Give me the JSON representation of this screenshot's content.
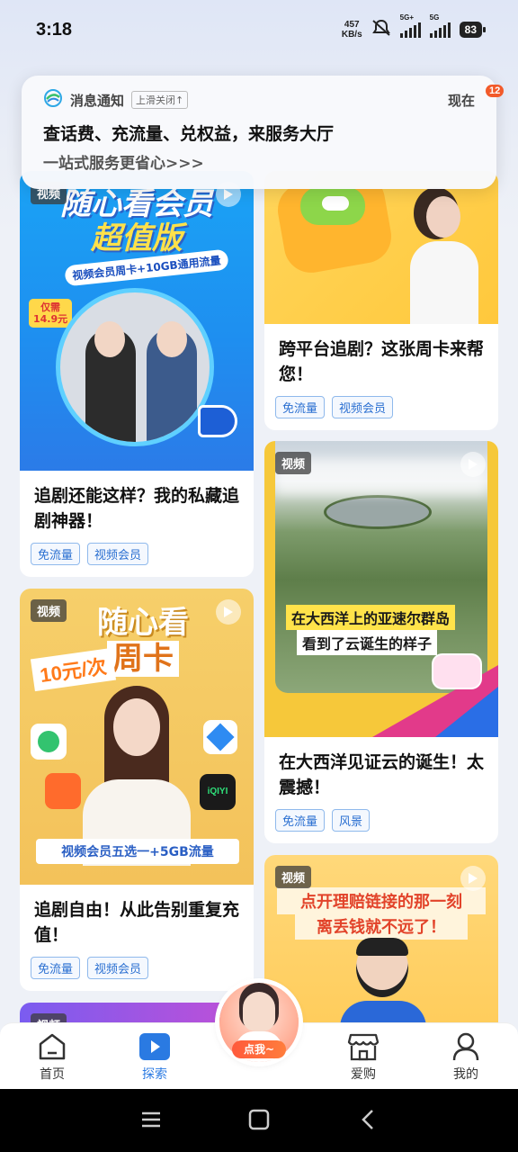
{
  "status_bar": {
    "time": "3:18",
    "net_speed": "457",
    "net_unit": "KB/s",
    "sim1": "5G+",
    "sim2": "5G",
    "battery": "83"
  },
  "notification": {
    "app_name": "消息通知",
    "dismiss_hint": "上滑关闭↑",
    "time": "现在",
    "title": "查话费、充流量、兑权益，来服务大厅",
    "body": "一站式服务更省心>>>",
    "unread_count": "12"
  },
  "feed": {
    "video_badge": "视频",
    "cards": [
      {
        "id": "left-1",
        "img_line1": "随心看会员",
        "img_line2": "超值版",
        "img_ribbon": "视频会员周卡+10GB通用流量",
        "img_price_a": "仅需",
        "img_price_b": "14.9元",
        "title": "追剧还能这样？我的私藏追剧神器！",
        "tags": [
          "免流量",
          "视频会员"
        ]
      },
      {
        "id": "right-1",
        "title": "跨平台追剧？这张周卡来帮您！",
        "tags": [
          "免流量",
          "视频会员"
        ]
      },
      {
        "id": "left-2",
        "img_line1": "随心看",
        "img_line2": "周卡",
        "img_left": "10元/次",
        "img_ribbon": "视频会员五选一+5GB流量",
        "title": "追剧自由！从此告别重复充值！",
        "tags": [
          "免流量",
          "视频会员"
        ]
      },
      {
        "id": "right-2",
        "img_line1": "在大西洋上的亚速尔群岛",
        "img_line2": "看到了云诞生的样子",
        "title": "在大西洋见证云的诞生！太震撼！",
        "tags": [
          "免流量",
          "风景"
        ]
      },
      {
        "id": "right-3",
        "img_line1": "点开理赔链接的那一刻",
        "img_line2": "离丢钱就不远了！"
      }
    ]
  },
  "tabbar": {
    "items": [
      {
        "label": "首页",
        "icon": "home-icon"
      },
      {
        "label": "探索",
        "icon": "explore-play-icon"
      },
      {
        "label": "爱购",
        "icon": "store-icon"
      },
      {
        "label": "我的",
        "icon": "profile-icon"
      }
    ],
    "fab_label": "点我~",
    "active": "探索"
  },
  "colors": {
    "accent": "#2a7ae2",
    "tag_text": "#2a6fd1",
    "badge": "#f25a2a"
  }
}
